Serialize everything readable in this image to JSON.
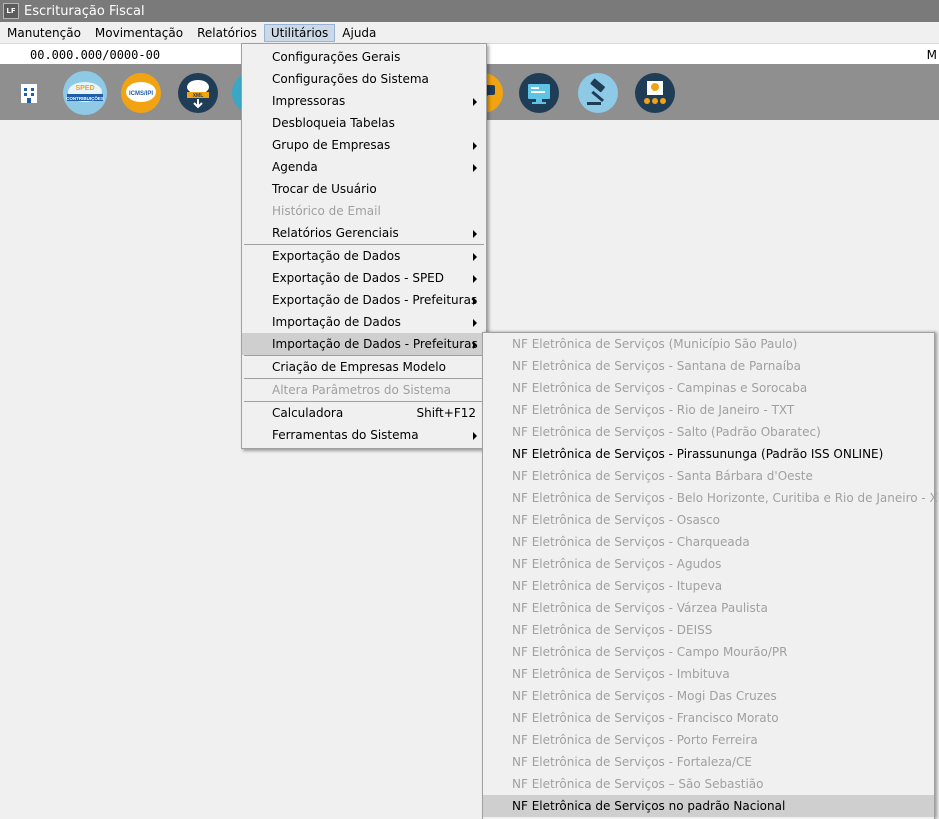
{
  "window": {
    "logo": "LF",
    "title": "Escrituração Fiscal"
  },
  "menubar": [
    "Manutenção",
    "Movimentação",
    "Relatórios",
    "Utilitários",
    "Ajuda"
  ],
  "infobar": {
    "cnpj": "00.000.000/0000-00",
    "right_text": "M"
  },
  "toolbar": {
    "icons": [
      {
        "name": "building-icon",
        "label": "",
        "color": "#f2a312"
      },
      {
        "name": "sped-contribuicoes-icon",
        "label": "SPED CONTRIBUIÇÕES",
        "color": "#8ec9e6"
      },
      {
        "name": "icms-ipi-icon",
        "label": "ICMS/IPI",
        "color": "#f2a312"
      },
      {
        "name": "xml-cloud-icon",
        "label": "XML",
        "color": "#1f3d56"
      },
      {
        "name": "partial-icon",
        "label": "",
        "color": "#3aa7c4"
      },
      {
        "name": "chat-icon",
        "label": "",
        "color": "#f2a312"
      },
      {
        "name": "computer-icon",
        "label": "",
        "color": "#1f3d56"
      },
      {
        "name": "gavel-icon",
        "label": "",
        "color": "#8ec9e6"
      },
      {
        "name": "users-icon",
        "label": "",
        "color": "#1f3d56"
      }
    ]
  },
  "utilitarios_menu": {
    "items": [
      {
        "label": "Configurações Gerais",
        "submenu": false,
        "disabled": false
      },
      {
        "label": "Configurações do Sistema",
        "submenu": false,
        "disabled": false
      },
      {
        "label": "Impressoras",
        "submenu": true,
        "disabled": false
      },
      {
        "label": "Desbloqueia Tabelas",
        "submenu": false,
        "disabled": false
      },
      {
        "label": "Grupo de Empresas",
        "submenu": true,
        "disabled": false
      },
      {
        "label": "Agenda",
        "submenu": true,
        "disabled": false
      },
      {
        "label": "Trocar de Usuário",
        "submenu": false,
        "disabled": false
      },
      {
        "label": "Histórico de Email",
        "submenu": false,
        "disabled": true
      },
      {
        "label": "Relatórios Gerenciais",
        "submenu": true,
        "disabled": false
      },
      {
        "label": "Exportação de Dados",
        "submenu": true,
        "disabled": false
      },
      {
        "label": "Exportação de Dados - SPED",
        "submenu": true,
        "disabled": false
      },
      {
        "label": "Exportação de Dados - Prefeituras",
        "submenu": true,
        "disabled": false
      },
      {
        "label": "Importação de Dados",
        "submenu": true,
        "disabled": false
      },
      {
        "label": "Importação de Dados - Prefeituras",
        "submenu": true,
        "disabled": false
      },
      {
        "label": "Criação de Empresas Modelo",
        "submenu": false,
        "disabled": false
      },
      {
        "label": "Altera Parâmetros do Sistema",
        "submenu": false,
        "disabled": true
      },
      {
        "label": "Calculadora",
        "submenu": false,
        "disabled": false,
        "shortcut": "Shift+F12"
      },
      {
        "label": "Ferramentas do Sistema",
        "submenu": true,
        "disabled": false
      }
    ]
  },
  "prefeituras_submenu": {
    "items": [
      {
        "label": "NF Eletrônica de Serviços (Município São Paulo)",
        "disabled": true
      },
      {
        "label": "NF Eletrônica de Serviços - Santana de Parnaíba",
        "disabled": true
      },
      {
        "label": "NF Eletrônica de Serviços - Campinas e Sorocaba",
        "disabled": true
      },
      {
        "label": "NF Eletrônica de Serviços - Rio de Janeiro - TXT",
        "disabled": true
      },
      {
        "label": "NF Eletrônica de Serviços - Salto (Padrão Obaratec)",
        "disabled": true
      },
      {
        "label": "NF Eletrônica de Serviços - Pirassununga (Padrão ISS ONLINE)",
        "disabled": false
      },
      {
        "label": "NF Eletrônica de Serviços - Santa Bárbara d'Oeste",
        "disabled": true
      },
      {
        "label": "NF Eletrônica de Serviços - Belo Horizonte, Curitiba e Rio de Janeiro - XML",
        "disabled": true
      },
      {
        "label": "NF Eletrônica de Serviços - Osasco",
        "disabled": true
      },
      {
        "label": "NF Eletrônica de Serviços - Charqueada",
        "disabled": true
      },
      {
        "label": "NF Eletrônica de Serviços - Agudos",
        "disabled": true
      },
      {
        "label": "NF Eletrônica de Serviços - Itupeva",
        "disabled": true
      },
      {
        "label": "NF Eletrônica de Serviços - Várzea Paulista",
        "disabled": true
      },
      {
        "label": "NF Eletrônica de Serviços - DEISS",
        "disabled": true
      },
      {
        "label": "NF Eletrônica de Serviços - Campo Mourão/PR",
        "disabled": true
      },
      {
        "label": "NF Eletrônica de Serviços - Imbituva",
        "disabled": true
      },
      {
        "label": "NF Eletrônica de Serviços - Mogi Das Cruzes",
        "disabled": true
      },
      {
        "label": "NF Eletrônica de Serviços - Francisco Morato",
        "disabled": true
      },
      {
        "label": "NF Eletrônica de Serviços - Porto Ferreira",
        "disabled": true
      },
      {
        "label": "NF Eletrônica de Serviços - Fortaleza/CE",
        "disabled": true
      },
      {
        "label": "NF Eletrônica de Serviços – São Sebastião",
        "disabled": true
      },
      {
        "label": "NF Eletrônica de Serviços no padrão Nacional",
        "disabled": false
      }
    ]
  }
}
